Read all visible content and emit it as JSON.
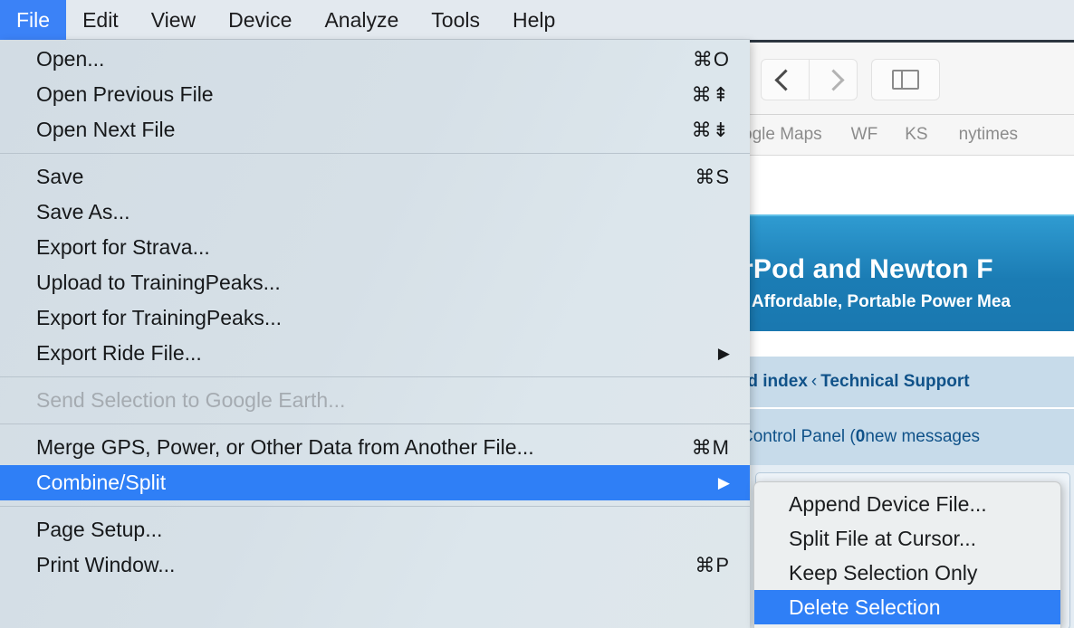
{
  "menubar": {
    "items": [
      {
        "label": "File",
        "active": true
      },
      {
        "label": "Edit",
        "active": false
      },
      {
        "label": "View",
        "active": false
      },
      {
        "label": "Device",
        "active": false
      },
      {
        "label": "Analyze",
        "active": false
      },
      {
        "label": "Tools",
        "active": false
      },
      {
        "label": "Help",
        "active": false
      }
    ]
  },
  "file_menu": {
    "groups": [
      {
        "items": [
          {
            "label": "Open...",
            "shortcut": "⌘O",
            "arrow": "",
            "state": "normal"
          },
          {
            "label": "Open Previous File",
            "shortcut": "⌘⇞",
            "arrow": "",
            "state": "normal"
          },
          {
            "label": "Open Next File",
            "shortcut": "⌘⇟",
            "arrow": "",
            "state": "normal"
          }
        ]
      },
      {
        "items": [
          {
            "label": "Save",
            "shortcut": "⌘S",
            "arrow": "",
            "state": "normal"
          },
          {
            "label": "Save As...",
            "shortcut": "",
            "arrow": "",
            "state": "normal"
          },
          {
            "label": "Export for Strava...",
            "shortcut": "",
            "arrow": "",
            "state": "normal"
          },
          {
            "label": "Upload to TrainingPeaks...",
            "shortcut": "",
            "arrow": "",
            "state": "normal"
          },
          {
            "label": "Export for TrainingPeaks...",
            "shortcut": "",
            "arrow": "",
            "state": "normal"
          },
          {
            "label": "Export Ride File...",
            "shortcut": "",
            "arrow": "▶",
            "state": "normal"
          }
        ]
      },
      {
        "items": [
          {
            "label": "Send Selection to Google Earth...",
            "shortcut": "",
            "arrow": "",
            "state": "disabled"
          }
        ]
      },
      {
        "items": [
          {
            "label": "Merge GPS, Power, or Other Data from Another File...",
            "shortcut": "⌘M",
            "arrow": "",
            "state": "normal"
          },
          {
            "label": "Combine/Split",
            "shortcut": "",
            "arrow": "▶",
            "state": "selected"
          }
        ]
      },
      {
        "items": [
          {
            "label": "Page Setup...",
            "shortcut": "",
            "arrow": "",
            "state": "normal"
          },
          {
            "label": "Print Window...",
            "shortcut": "⌘P",
            "arrow": "",
            "state": "normal"
          }
        ]
      }
    ]
  },
  "submenu": {
    "items": [
      {
        "label": "Append Device File...",
        "state": "normal"
      },
      {
        "label": "Split File at Cursor...",
        "state": "normal"
      },
      {
        "label": "Keep Selection Only",
        "state": "normal"
      },
      {
        "label": "Delete Selection",
        "state": "selected"
      }
    ]
  },
  "browser": {
    "toolbar": {
      "back_icon": "chevron-left-icon",
      "forward_icon": "chevron-right-icon",
      "sidebar_icon": "sidebar-toggle-icon"
    },
    "bookmarks": [
      "ogle Maps",
      "WF",
      "KS",
      "nytimes"
    ],
    "banner": {
      "title": "rPod and Newton F",
      "subtitle": ", Affordable, Portable Power Mea"
    },
    "breadcrumb": {
      "part1": "rd index",
      "separator": "‹",
      "part2": "Technical Support"
    },
    "control_panel": {
      "prefix": "Control Panel (",
      "count": "0",
      "suffix": " new messages"
    }
  },
  "colors": {
    "menu_highlight": "#2f7ff6",
    "menubar_active": "#3b82f7",
    "banner_blue": "#1b7cb4",
    "link_blue": "#105289",
    "disabled_gray": "#a5abb1"
  }
}
